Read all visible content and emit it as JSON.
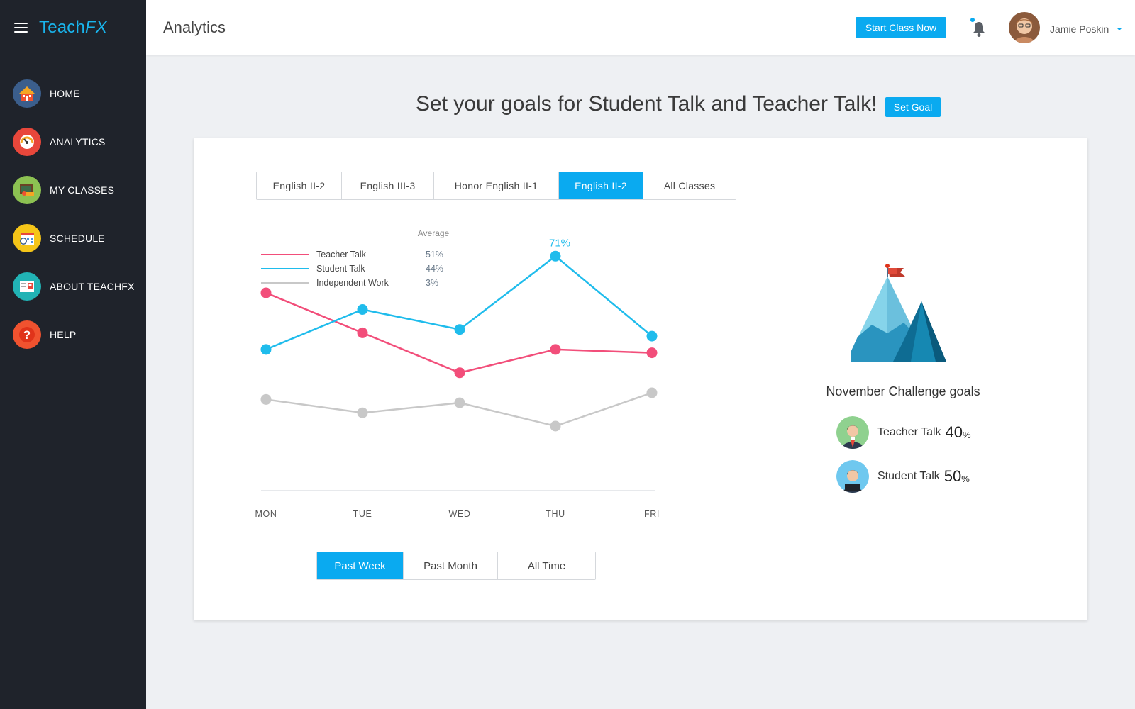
{
  "brand": {
    "name_part1": "Teach",
    "name_part2": "FX",
    "color": "#19b4ec"
  },
  "sidebar": {
    "items": [
      {
        "label": "HOME",
        "icon": "home-icon",
        "color": "#3b5e8c"
      },
      {
        "label": "ANALYTICS",
        "icon": "speedometer-icon",
        "color": "#e8473b"
      },
      {
        "label": "MY CLASSES",
        "icon": "classroom-icon",
        "color": "#8cc152"
      },
      {
        "label": "SCHEDULE",
        "icon": "calendar-icon",
        "color": "#f5c518"
      },
      {
        "label": "ABOUT TEACHFX",
        "icon": "profile-card-icon",
        "color": "#21b3b5"
      },
      {
        "label": "HELP",
        "icon": "question-icon",
        "color": "#f0522f"
      }
    ]
  },
  "header": {
    "title": "Analytics",
    "start_button": "Start Class Now",
    "user_name": "Jamie Poskin"
  },
  "goals": {
    "heading": "Set your goals for Student Talk and Teacher Talk!",
    "set_goal_button": "Set Goal"
  },
  "class_tabs": [
    {
      "label": "English II-2",
      "active": false
    },
    {
      "label": "English III-3",
      "active": false
    },
    {
      "label": "Honor English II-1",
      "active": false
    },
    {
      "label": "English II-2",
      "active": true
    },
    {
      "label": "All Classes",
      "active": false
    }
  ],
  "legend": {
    "average_label": "Average",
    "items": [
      {
        "label": "Teacher Talk",
        "value": "51%",
        "color": "#f24e7a"
      },
      {
        "label": "Student Talk",
        "value": "44%",
        "color": "#1fbcec"
      },
      {
        "label": "Independent Work",
        "value": "3%",
        "color": "#c8c8c8"
      }
    ]
  },
  "chart_data": {
    "type": "line",
    "x": [
      "MON",
      "TUE",
      "WED",
      "THU",
      "FRI"
    ],
    "series": [
      {
        "name": "Teacher Talk",
        "color": "#f24e7a",
        "values": [
          60,
          48,
          36,
          43,
          42
        ]
      },
      {
        "name": "Student Talk",
        "color": "#1fbcec",
        "values": [
          43,
          55,
          49,
          71,
          47
        ]
      },
      {
        "name": "Independent Work",
        "color": "#c8c8c8",
        "values": [
          28,
          24,
          27,
          20,
          30
        ]
      }
    ],
    "annotations": [
      {
        "series": "Student Talk",
        "x": "THU",
        "label": "71%"
      }
    ],
    "ylim": [
      0,
      80
    ]
  },
  "range_tabs": [
    {
      "label": "Past Week",
      "active": true
    },
    {
      "label": "Past Month",
      "active": false
    },
    {
      "label": "All Time",
      "active": false
    }
  ],
  "challenge": {
    "title": "November Challenge goals",
    "goals": [
      {
        "label": "Teacher Talk",
        "value": "40",
        "unit": "%"
      },
      {
        "label": "Student Talk",
        "value": "50",
        "unit": "%"
      }
    ]
  }
}
